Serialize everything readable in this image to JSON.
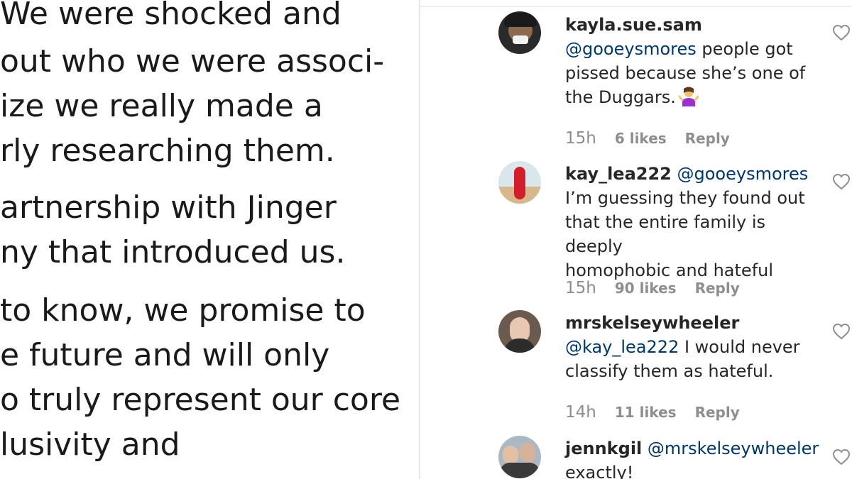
{
  "statement": {
    "lines": [
      "We were shocked and",
      "out who we were associ-",
      "ize we really made a",
      "rly researching them.",
      "artnership with Jinger",
      "ny that introduced us.",
      "to know, we promise to",
      "e future and will only",
      "o truly represent our core",
      "lusivity and"
    ]
  },
  "comments": [
    {
      "username": "kayla.sue.sam",
      "mention": "@gooeysmores",
      "text_lines": [
        " people got",
        "pissed because she’s one of",
        "the Duggars."
      ],
      "emoji": "person-shrugging-emoji",
      "time": "15h",
      "likes": "6 likes",
      "reply": "Reply"
    },
    {
      "username": "kay_lea222",
      "mention": "@gooeysmores",
      "text_lines": [
        "I’m guessing they found out",
        "that the entire family is deeply",
        "homophobic and hateful"
      ],
      "time": "15h",
      "likes": "90 likes",
      "reply": "Reply"
    },
    {
      "username": "mrskelseywheeler",
      "mention": "@kay_lea222",
      "text_lines": [
        " I would never",
        "classify them as hateful."
      ],
      "time": "14h",
      "likes": "11 likes",
      "reply": "Reply"
    },
    {
      "username": "jennkgil",
      "mention": "@mrskelseywheeler",
      "text_lines": [
        "exactly!"
      ]
    }
  ],
  "colors": {
    "text": "#262626",
    "mention": "#00376b",
    "meta": "#8e8e8e",
    "emoji": "#9b2fd0"
  },
  "icons": {
    "like": "heart-outline-icon"
  }
}
